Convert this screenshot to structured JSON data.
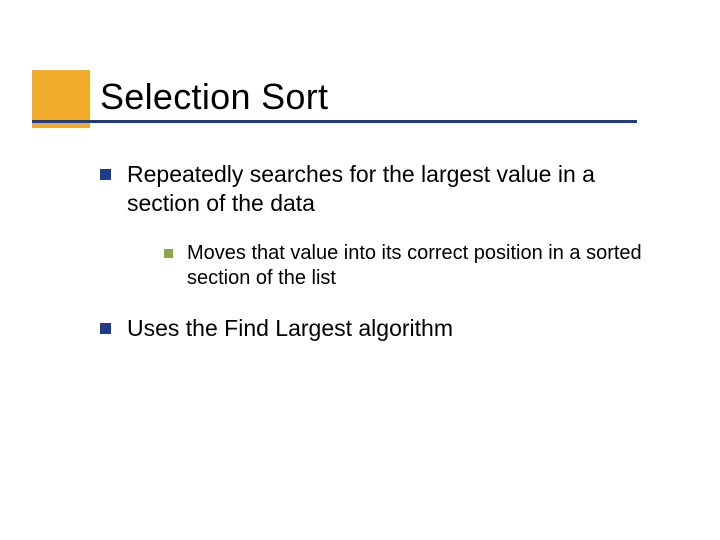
{
  "title": "Selection Sort",
  "bullets": {
    "item1": "Repeatedly searches for the largest value in a section of the data",
    "sub1": "Moves that value into its correct position in a sorted section of the list",
    "item2": "Uses the Find Largest algorithm"
  }
}
